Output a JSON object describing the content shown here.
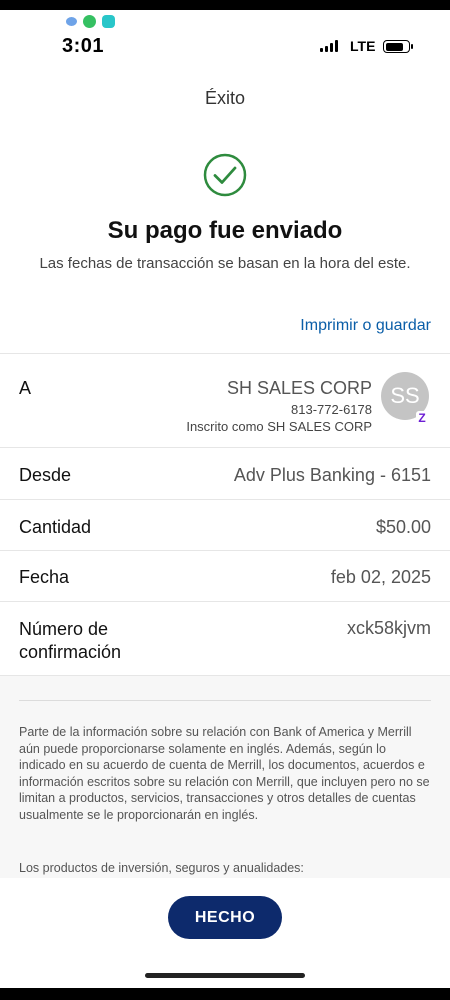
{
  "status_bar": {
    "time": "3:01",
    "network": "LTE",
    "notification_icons": [
      "message-icon",
      "whatsapp-icon",
      "app-icon"
    ]
  },
  "header": {
    "title": "Éxito"
  },
  "confirmation": {
    "icon": "check-circle-icon",
    "headline": "Su pago fue enviado",
    "subline": "Las fechas de transacción se basan en la hora del este."
  },
  "actions": {
    "print_label": "Imprimir o guardar",
    "done_label": "HECHO"
  },
  "details": {
    "to_label": "A",
    "payee_name": "SH SALES CORP",
    "payee_phone": "813-772-6178",
    "payee_enrolled": "Inscrito como SH SALES CORP",
    "payee_initials": "SS",
    "from_label": "Desde",
    "from_value": "Adv Plus Banking - 6151",
    "amount_label": "Cantidad",
    "amount_value": "$50.00",
    "date_label": "Fecha",
    "date_value": "feb 02, 2025",
    "confirmation_label_line1": "Número de",
    "confirmation_label_line2": "confirmación",
    "confirmation_value": "xck58kjvm"
  },
  "disclaimer": {
    "paragraph1": "Parte de la información sobre su relación con Bank of America y Merrill aún puede proporcionarse solamente en inglés. Además, según lo indicado en su acuerdo de cuenta de Merrill, los documentos, acuerdos e información escritos sobre su relación con Merrill, que incluyen pero no se limitan a productos, servicios, transacciones y otros detalles de cuentas usualmente se le proporcionarán en inglés.",
    "paragraph2": "Los productos de inversión, seguros y anualidades:"
  },
  "colors": {
    "success_green": "#2e8b3e",
    "link_blue": "#0a5ea8",
    "button_navy": "#0d2a6c",
    "zelle_purple": "#6d1ed4"
  }
}
